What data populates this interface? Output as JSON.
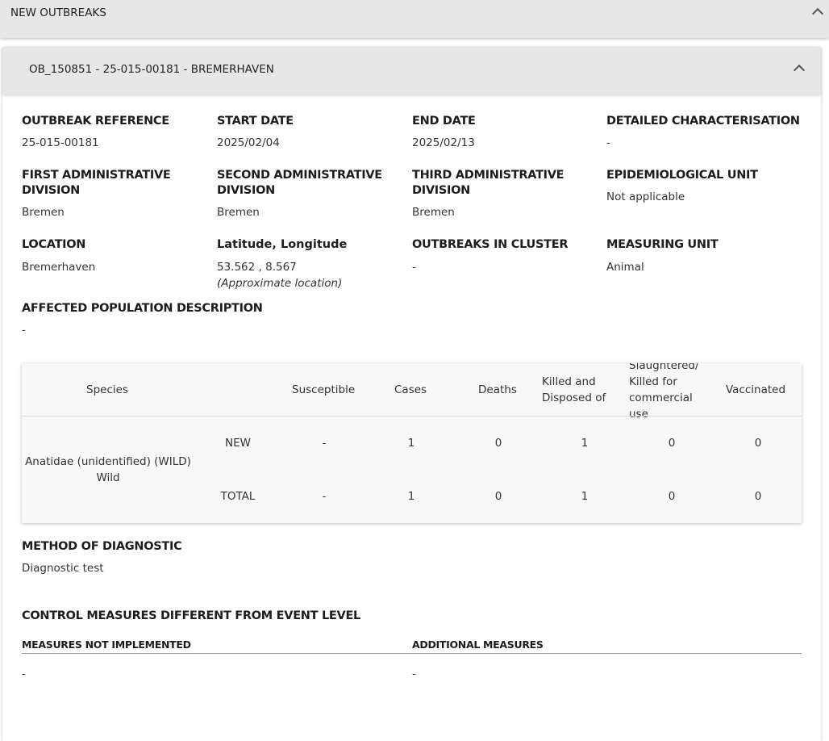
{
  "section": {
    "title": "NEW OUTBREAKS"
  },
  "outbreak": {
    "title": "OB_150851 - 25-015-00181 - BREMERHAVEN",
    "fields": {
      "reference": {
        "label": "OUTBREAK REFERENCE",
        "value": "25-015-00181"
      },
      "start_date": {
        "label": "START DATE",
        "value": "2025/02/04"
      },
      "end_date": {
        "label": "END DATE",
        "value": "2025/02/13"
      },
      "detailed_char": {
        "label": "DETAILED CHARACTERISATION",
        "value": "-"
      },
      "first_admin": {
        "label_line1": "FIRST ADMINISTRATIVE",
        "label_line2": "DIVISION",
        "value": "Bremen"
      },
      "second_admin": {
        "label_line1": "SECOND ADMINISTRATIVE",
        "label_line2": "DIVISION",
        "value": "Bremen"
      },
      "third_admin": {
        "label_line1": "THIRD ADMINISTRATIVE",
        "label_line2": "DIVISION",
        "value": "Bremen"
      },
      "epi_unit": {
        "label": "EPIDEMIOLOGICAL UNIT",
        "value": "Not applicable"
      },
      "location": {
        "label": "LOCATION",
        "value": "Bremerhaven"
      },
      "latlon": {
        "label": "Latitude, Longitude",
        "value": "53.562 , 8.567",
        "note": "(Approximate location)"
      },
      "cluster": {
        "label": "OUTBREAKS IN CLUSTER",
        "value": "-"
      },
      "measuring_unit": {
        "label": "MEASURING UNIT",
        "value": "Animal"
      },
      "affected_pop": {
        "label": "AFFECTED POPULATION DESCRIPTION",
        "value": "-"
      }
    },
    "table": {
      "headers": {
        "species": "Species",
        "susceptible": "Susceptible",
        "cases": "Cases",
        "deaths": "Deaths",
        "killed_l1": "Killed and",
        "killed_l2": "Disposed of",
        "slaughtered_l1": "Slaughtered/",
        "slaughtered_l2": "Killed for",
        "slaughtered_l3": "commercial",
        "slaughtered_l4": "use",
        "vaccinated": "Vaccinated"
      },
      "species_name": "Anatidae (unidentified) (WILD)",
      "species_type": "Wild",
      "rows": [
        {
          "label": "NEW",
          "susceptible": "-",
          "cases": "1",
          "deaths": "0",
          "killed": "1",
          "slaughtered": "0",
          "vaccinated": "0"
        },
        {
          "label": "TOTAL",
          "susceptible": "-",
          "cases": "1",
          "deaths": "0",
          "killed": "1",
          "slaughtered": "0",
          "vaccinated": "0"
        }
      ]
    },
    "diagnostic": {
      "label": "METHOD OF DIAGNOSTIC",
      "value": "Diagnostic test"
    },
    "control": {
      "title": "CONTROL MEASURES DIFFERENT FROM EVENT LEVEL",
      "not_implemented": {
        "label": "MEASURES NOT IMPLEMENTED",
        "value": "-"
      },
      "additional": {
        "label": "ADDITIONAL MEASURES",
        "value": "-"
      }
    }
  }
}
